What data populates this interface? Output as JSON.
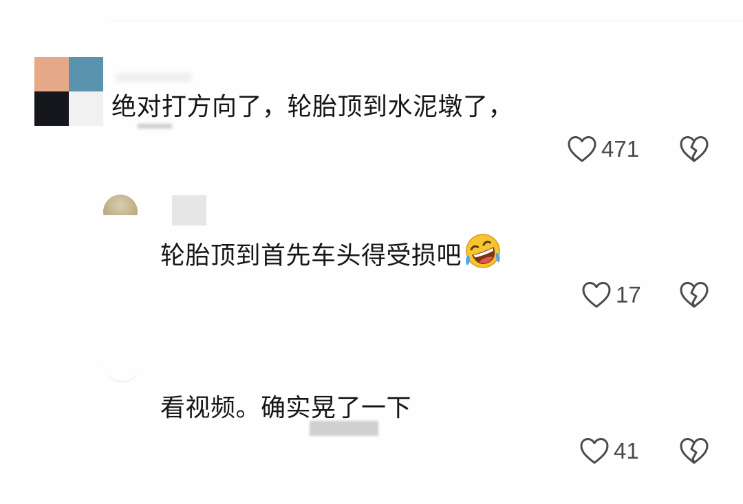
{
  "comments": [
    {
      "text": "绝对打方向了，轮胎顶到水泥墩了，",
      "likes": "471"
    },
    {
      "text": "轮胎顶到首先车头得受损吧",
      "emoji": "rolling-on-floor-laughing",
      "likes": "17"
    },
    {
      "text": "看视频。确实晃了一下",
      "likes": "41"
    }
  ],
  "icons": {
    "like": "heart-outline-icon",
    "dislike": "broken-heart-icon"
  },
  "colors": {
    "background": "#fefefe",
    "text": "#161616",
    "count": "#4a4a4a",
    "icon": "#4a4a4a"
  }
}
